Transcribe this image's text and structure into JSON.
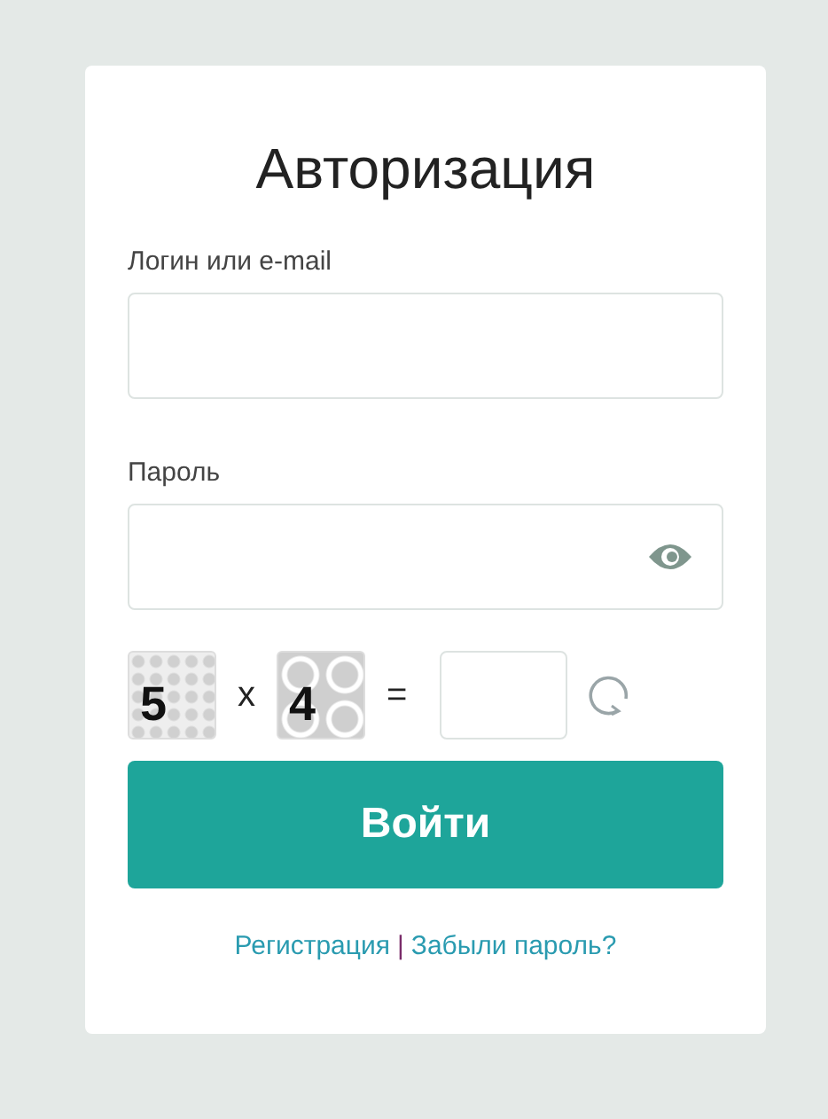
{
  "title": "Авторизация",
  "fields": [
    {
      "label": "Логин или e-mail",
      "kind": "text"
    },
    {
      "label": "Пароль",
      "kind": "password"
    }
  ],
  "captcha": {
    "first": "5",
    "operator": "x",
    "second": "4",
    "equals": "="
  },
  "submit": "Войти",
  "links": [
    {
      "label": "Регистрация"
    },
    {
      "label": "Забыли пароль?"
    }
  ],
  "separator": "|"
}
